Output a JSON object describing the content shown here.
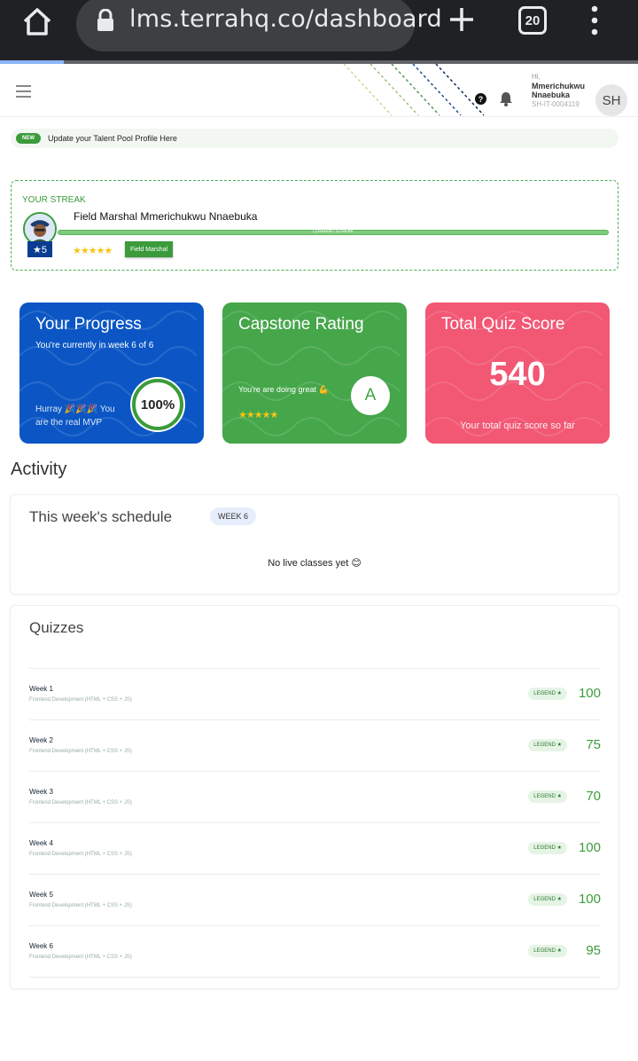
{
  "browser": {
    "url": "lms.terrahq.co/dashboard",
    "tab_count": "20",
    "load_progress": 0.1
  },
  "header": {
    "greeting": "Hi,",
    "user_name": "Mmerichukwu Nnaebuka",
    "user_id": "SH-IT-0004119",
    "avatar_initials": "SH",
    "help_glyph": "?"
  },
  "announcement": {
    "badge": "NEW",
    "text": "Update your Talent Pool Profile Here"
  },
  "streak": {
    "title": "YOUR STREAK",
    "name": "Field Marshal Mmerichukwu Nnaebuka",
    "bar_label": "CURRENT STREAK",
    "level": "★5",
    "stars": "★★★★★",
    "rank": "Field Marshal",
    "progress": 1.0
  },
  "cards": {
    "progress": {
      "title": "Your Progress",
      "subtitle": "You're currently in week 6 of 6",
      "footer": "Hurray 🎉🎉🎉 You are the real MVP",
      "value": "100%",
      "fraction": 1.0,
      "color": "#0b56c4"
    },
    "capstone": {
      "title": "Capstone Rating",
      "text": "You're are doing great 💪",
      "stars": "★★★★★",
      "grade": "A",
      "color": "#45a64a"
    },
    "quiz": {
      "title": "Total Quiz Score",
      "score": "540",
      "caption": "Your total quiz score so far",
      "color": "#f25774"
    }
  },
  "activity": {
    "title": "Activity",
    "schedule": {
      "title": "This week's schedule",
      "week_badge": "WEEK 6",
      "empty_text": "No live classes yet 😊"
    },
    "quizzes": {
      "title": "Quizzes",
      "rows": [
        {
          "week": "Week 1",
          "course": "Frontend Development (HTML + CSS + JS)",
          "tag": "LEGEND ★",
          "score": "100"
        },
        {
          "week": "Week 2",
          "course": "Frontend Development (HTML + CSS + JS)",
          "tag": "LEGEND ★",
          "score": "75"
        },
        {
          "week": "Week 3",
          "course": "Frontend Development (HTML + CSS + JS)",
          "tag": "LEGEND ★",
          "score": "70"
        },
        {
          "week": "Week 4",
          "course": "Frontend Development (HTML + CSS + JS)",
          "tag": "LEGEND ★",
          "score": "100"
        },
        {
          "week": "Week 5",
          "course": "Frontend Development (HTML + CSS + JS)",
          "tag": "LEGEND ★",
          "score": "100"
        },
        {
          "week": "Week 6",
          "course": "Frontend Development (HTML + CSS + JS)",
          "tag": "LEGEND ★",
          "score": "95"
        }
      ]
    }
  },
  "colors": {
    "accent_green": "#3b9b3b",
    "star_yellow": "#f5c518"
  }
}
